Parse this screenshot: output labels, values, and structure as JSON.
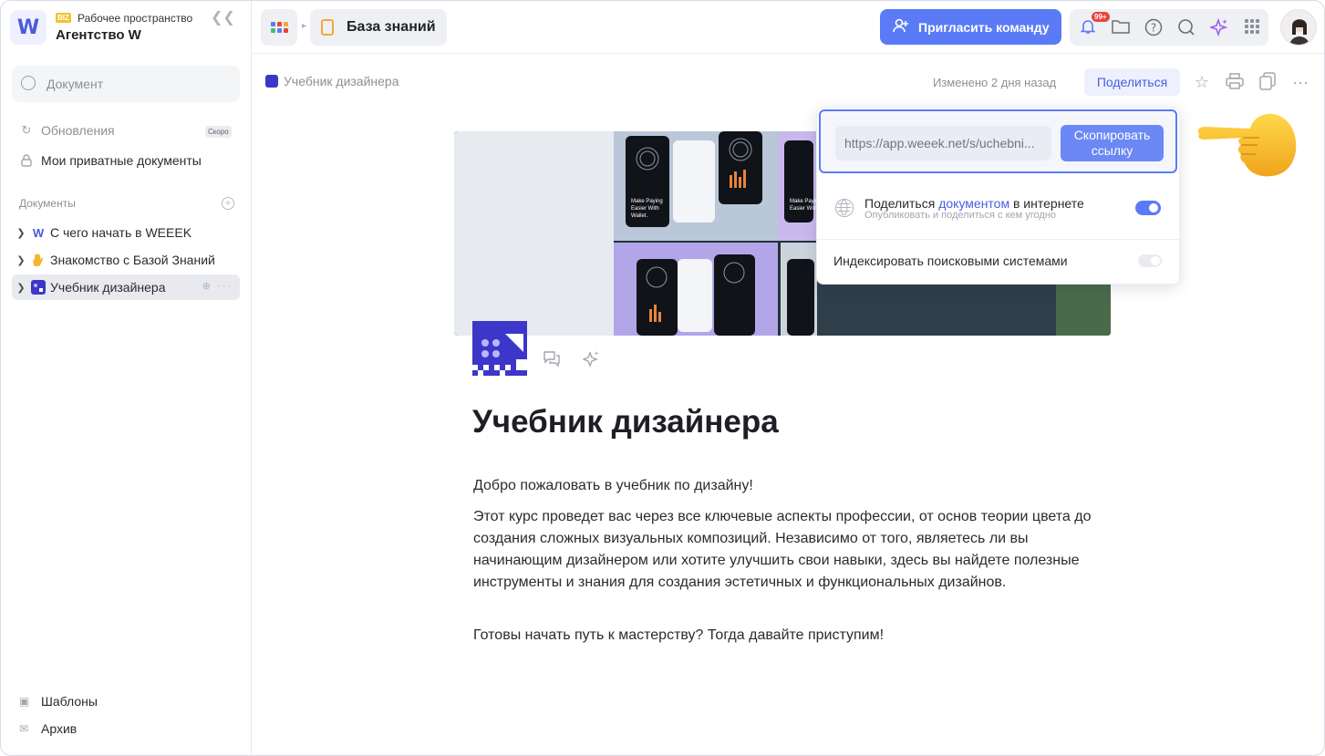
{
  "workspace": {
    "logo_letter": "W",
    "badge": "BIZ",
    "label": "Рабочее пространство",
    "name": "Агентство W"
  },
  "sidebar": {
    "search_placeholder": "Документ",
    "updates_label": "Обновления",
    "soon_badge": "Скоро",
    "private_docs_label": "Мои приватные документы",
    "section_title": "Документы",
    "documents": [
      {
        "label": "С чего начать в WEEEK",
        "icon": "weeek-logo-icon"
      },
      {
        "label": "Знакомство с Базой Знаний",
        "icon": "hand-emoji-icon"
      },
      {
        "label": "Учебник дизайнера",
        "icon": "pattern-icon",
        "active": true
      }
    ],
    "templates_label": "Шаблоны",
    "archive_label": "Архив"
  },
  "topbar": {
    "breadcrumb": "База знаний",
    "invite_label": "Пригласить команду",
    "notifications_badge": "99+"
  },
  "doc_header": {
    "crumb": "Учебник дизайнера",
    "modified": "Изменено 2 дня назад",
    "share_label": "Поделиться"
  },
  "share_popup": {
    "link_placeholder": "https://app.weeek.net/s/uchebni...",
    "copy_label_1": "Скопировать",
    "copy_label_2": "ссылку",
    "publish_prefix": "Поделиться ",
    "publish_link": "документом",
    "publish_suffix": " в интернете",
    "publish_sub": "Опубликовать и поделиться с кем угодно",
    "publish_enabled": true,
    "index_label": "Индексировать поисковыми системами",
    "index_enabled": false
  },
  "document": {
    "title": "Учебник дизайнера",
    "paragraphs": [
      "Добро пожаловать в учебник по дизайну!",
      "Этот курс проведет вас через все ключевые аспекты профессии, от основ теории цвета до создания сложных визуальных композиций. Независимо от того, являетесь ли вы начинающим дизайнером или хотите улучшить свои навыки, здесь вы найдете полезные инструменты и знания для создания эстетичных и функциональных дизайнов.",
      "Готовы начать путь к мастерству? Тогда давайте приступим!"
    ]
  },
  "colors": {
    "accent": "#5b7bf6",
    "doc_icon": "#3c37c9",
    "notif": "#e8453c",
    "folder": "#f2a93b"
  }
}
